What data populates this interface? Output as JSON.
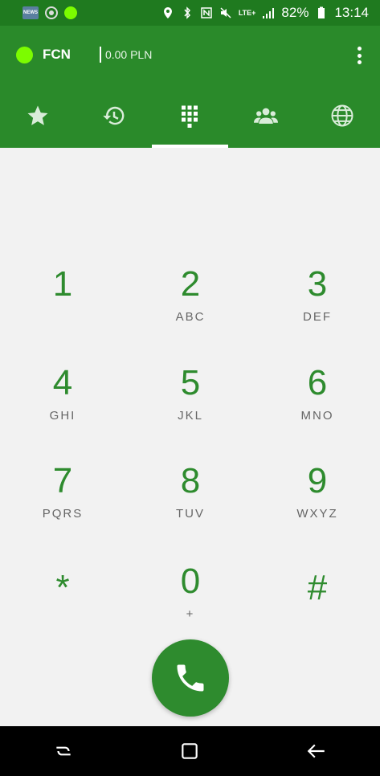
{
  "status_bar": {
    "app_icon_label": "NEWS",
    "battery_percent": "82%",
    "time": "13:14",
    "network": "LTE+"
  },
  "header": {
    "account_name": "FCN",
    "balance": "0.00 PLN",
    "presence_color": "#7CFC00",
    "brand_color": "#2a8a2a"
  },
  "tabs": [
    {
      "icon": "star-icon",
      "active": false
    },
    {
      "icon": "history-icon",
      "active": false
    },
    {
      "icon": "dialpad-icon",
      "active": true
    },
    {
      "icon": "contacts-icon",
      "active": false
    },
    {
      "icon": "globe-icon",
      "active": false
    }
  ],
  "dialpad": {
    "keys": [
      {
        "digit": "1",
        "letters": ""
      },
      {
        "digit": "2",
        "letters": "ABC"
      },
      {
        "digit": "3",
        "letters": "DEF"
      },
      {
        "digit": "4",
        "letters": "GHI"
      },
      {
        "digit": "5",
        "letters": "JKL"
      },
      {
        "digit": "6",
        "letters": "MNO"
      },
      {
        "digit": "7",
        "letters": "PQRS"
      },
      {
        "digit": "8",
        "letters": "TUV"
      },
      {
        "digit": "9",
        "letters": "WXYZ"
      },
      {
        "digit": "*",
        "letters": ""
      },
      {
        "digit": "0",
        "letters": "+"
      },
      {
        "digit": "#",
        "letters": ""
      }
    ]
  },
  "call_button": {
    "icon": "phone-icon"
  },
  "nav_bar": [
    "recents-icon",
    "home-icon",
    "back-icon"
  ]
}
